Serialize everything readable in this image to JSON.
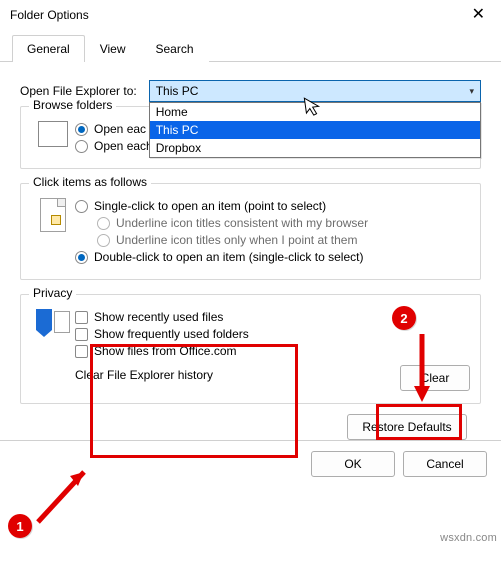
{
  "window": {
    "title": "Folder Options"
  },
  "tabs": {
    "general": "General",
    "view": "View",
    "search": "Search"
  },
  "openTo": {
    "label": "Open File Explorer to:",
    "value": "This PC",
    "options": [
      "Home",
      "This PC",
      "Dropbox"
    ]
  },
  "browse": {
    "legend": "Browse folders",
    "same": "Open each folder in the same window",
    "sameShort": "Open eac",
    "own": "Open each folder in its own window"
  },
  "click": {
    "legend": "Click items as follows",
    "single": "Single-click to open an item (point to select)",
    "u1": "Underline icon titles consistent with my browser",
    "u2": "Underline icon titles only when I point at them",
    "double": "Double-click to open an item (single-click to select)"
  },
  "privacy": {
    "legend": "Privacy",
    "recent": "Show recently used files",
    "freq": "Show frequently used folders",
    "office": "Show files from Office.com",
    "clearLabel": "Clear File Explorer history",
    "clearBtn": "Clear"
  },
  "buttons": {
    "restore": "Restore Defaults",
    "ok": "OK",
    "cancel": "Cancel"
  },
  "annotations": {
    "badge1": "1",
    "badge2": "2"
  },
  "watermark": "wsxdn.com"
}
